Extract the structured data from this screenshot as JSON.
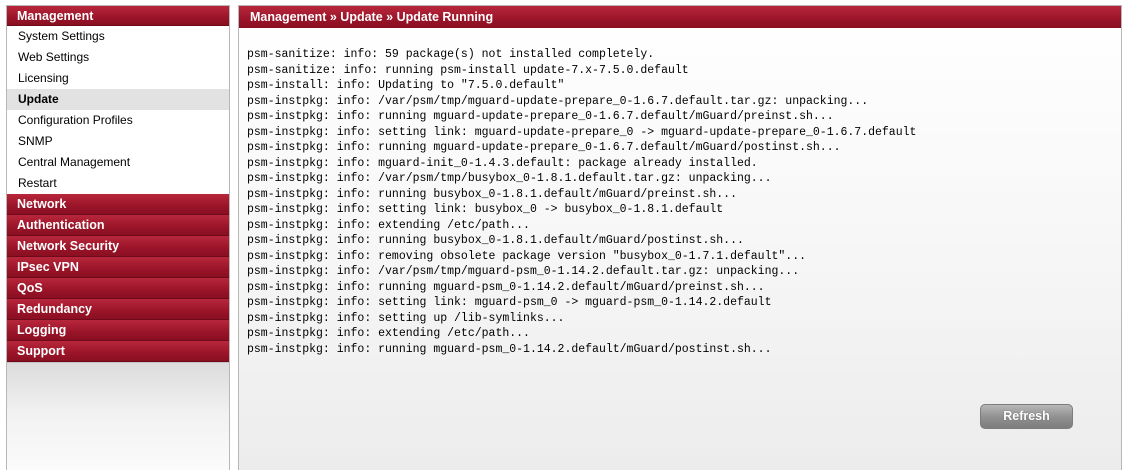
{
  "sidebar": {
    "sections": [
      {
        "label": "Management",
        "items": [
          "System Settings",
          "Web Settings",
          "Licensing",
          "Update",
          "Configuration Profiles",
          "SNMP",
          "Central Management",
          "Restart"
        ],
        "active_item": "Update"
      },
      {
        "label": "Network"
      },
      {
        "label": "Authentication"
      },
      {
        "label": "Network Security"
      },
      {
        "label": "IPsec VPN"
      },
      {
        "label": "QoS"
      },
      {
        "label": "Redundancy"
      },
      {
        "label": "Logging"
      },
      {
        "label": "Support"
      }
    ]
  },
  "header": {
    "breadcrumb": "Management » Update » Update Running"
  },
  "log_lines": [
    "psm-sanitize: info: 59 package(s) not installed completely.",
    "psm-sanitize: info: running psm-install update-7.x-7.5.0.default",
    "psm-install: info: Updating to \"7.5.0.default\"",
    "psm-instpkg: info: /var/psm/tmp/mguard-update-prepare_0-1.6.7.default.tar.gz: unpacking...",
    "psm-instpkg: info: running mguard-update-prepare_0-1.6.7.default/mGuard/preinst.sh...",
    "psm-instpkg: info: setting link: mguard-update-prepare_0 -> mguard-update-prepare_0-1.6.7.default",
    "psm-instpkg: info: running mguard-update-prepare_0-1.6.7.default/mGuard/postinst.sh...",
    "psm-instpkg: info: mguard-init_0-1.4.3.default: package already installed.",
    "psm-instpkg: info: /var/psm/tmp/busybox_0-1.8.1.default.tar.gz: unpacking...",
    "psm-instpkg: info: running busybox_0-1.8.1.default/mGuard/preinst.sh...",
    "psm-instpkg: info: setting link: busybox_0 -> busybox_0-1.8.1.default",
    "psm-instpkg: info: extending /etc/path...",
    "psm-instpkg: info: running busybox_0-1.8.1.default/mGuard/postinst.sh...",
    "psm-instpkg: info: removing obsolete package version \"busybox_0-1.7.1.default\"...",
    "psm-instpkg: info: /var/psm/tmp/mguard-psm_0-1.14.2.default.tar.gz: unpacking...",
    "psm-instpkg: info: running mguard-psm_0-1.14.2.default/mGuard/preinst.sh...",
    "psm-instpkg: info: setting link: mguard-psm_0 -> mguard-psm_0-1.14.2.default",
    "psm-instpkg: info: setting up /lib-symlinks...",
    "psm-instpkg: info: extending /etc/path...",
    "psm-instpkg: info: running mguard-psm_0-1.14.2.default/mGuard/postinst.sh..."
  ],
  "actions": {
    "refresh_label": "Refresh"
  },
  "colors": {
    "header_red": "#9a1428",
    "active_item_bg": "#e2e2e2",
    "button_gray": "#8f8f8f"
  }
}
